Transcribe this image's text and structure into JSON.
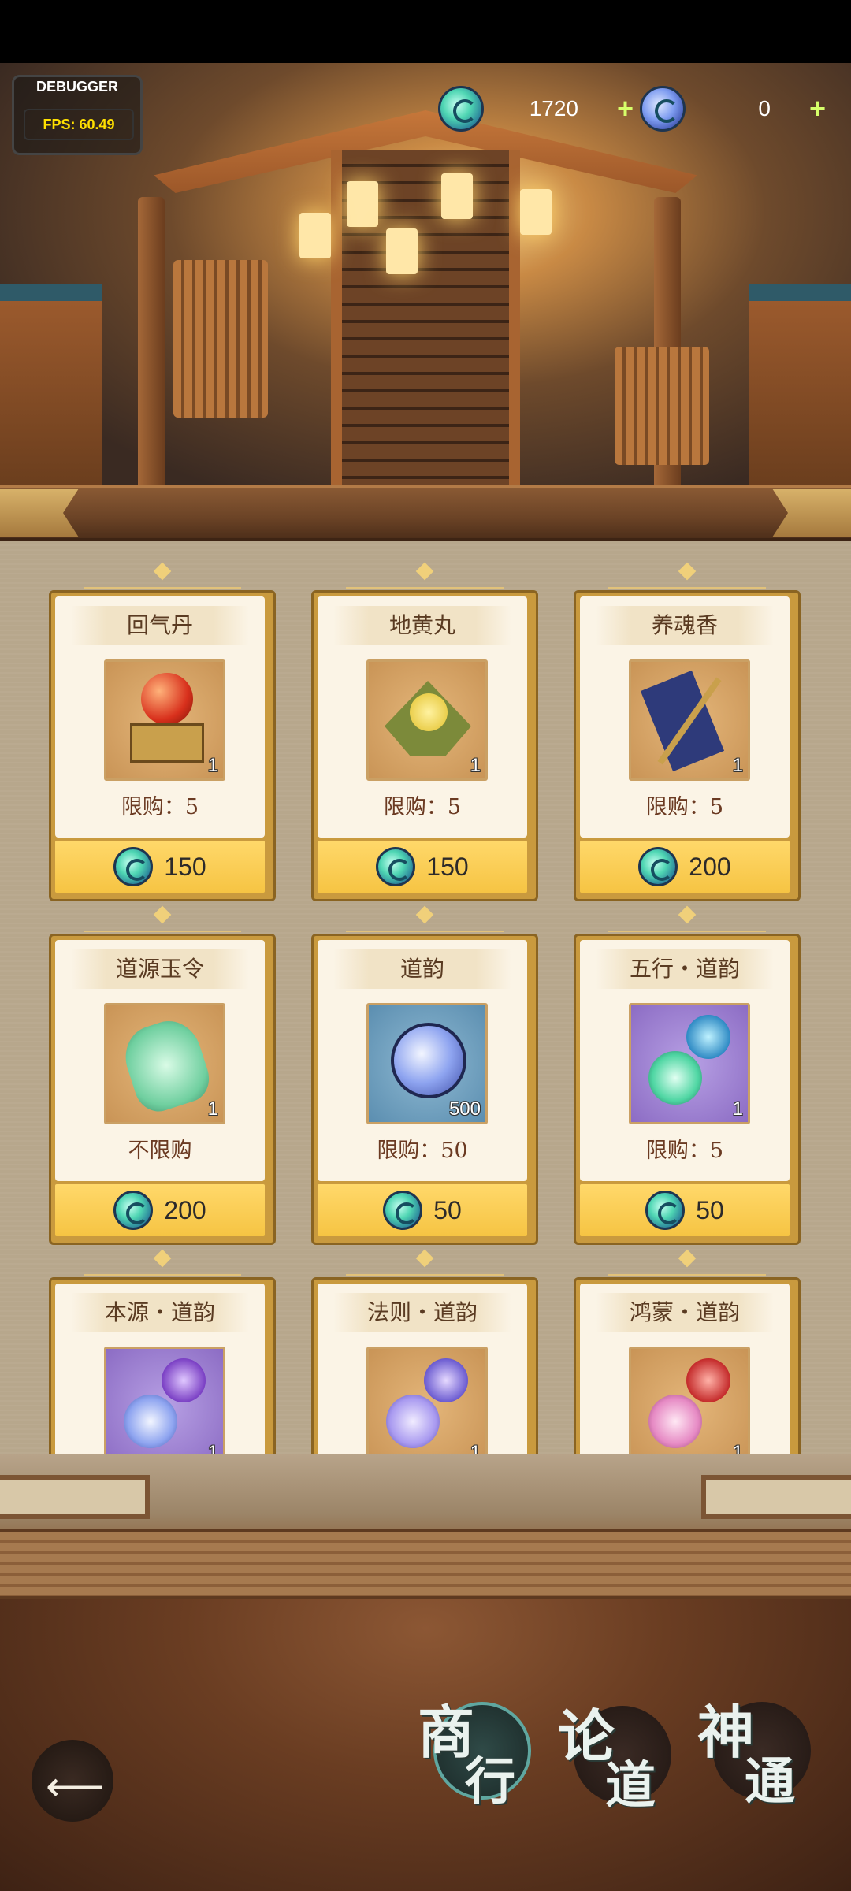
{
  "debugger": {
    "title": "DEBUGGER",
    "fps": "FPS: 60.49"
  },
  "resources": [
    {
      "icon": "jade-coin-icon",
      "value": "1720",
      "plus": "+"
    },
    {
      "icon": "blue-coin-icon",
      "value": "0",
      "plus": "+"
    }
  ],
  "items": [
    {
      "name": "回气丹",
      "qty": "1",
      "limit": "限购：5",
      "price": "150",
      "bg": "gold",
      "icon": "pill-pedestal-icon"
    },
    {
      "name": "地黄丸",
      "qty": "1",
      "limit": "限购：5",
      "price": "150",
      "bg": "gold",
      "icon": "herb-pill-icon"
    },
    {
      "name": "养魂香",
      "qty": "1",
      "limit": "限购：5",
      "price": "200",
      "bg": "gold",
      "icon": "incense-scroll-icon"
    },
    {
      "name": "道源玉令",
      "qty": "1",
      "limit": "不限购",
      "price": "200",
      "bg": "gold",
      "icon": "jade-token-icon"
    },
    {
      "name": "道韵",
      "qty": "500",
      "limit": "限购：50",
      "price": "50",
      "bg": "blue",
      "icon": "dao-orb-icon"
    },
    {
      "name": "五行・道韵",
      "qty": "1",
      "limit": "限购：5",
      "price": "50",
      "bg": "purple",
      "icon": "twin-orb-teal-icon"
    },
    {
      "name": "本源・道韵",
      "qty": "1",
      "limit": "",
      "price": "",
      "bg": "purple",
      "icon": "twin-orb-purple-icon"
    },
    {
      "name": "法则・道韵",
      "qty": "1",
      "limit": "",
      "price": "",
      "bg": "gold",
      "icon": "twin-orb-indigo-icon"
    },
    {
      "name": "鸿蒙・道韵",
      "qty": "1",
      "limit": "",
      "price": "",
      "bg": "gold",
      "icon": "twin-orb-red-icon"
    }
  ],
  "nav": {
    "back_icon": "back-arrow-icon",
    "tabs": [
      {
        "c1": "商",
        "c2": "行",
        "active": true
      },
      {
        "c1": "论",
        "c2": "道",
        "active": false
      },
      {
        "c1": "神",
        "c2": "通",
        "active": false
      }
    ]
  },
  "colors": {
    "price_bar": "#f6c443",
    "card_frame": "#c99a3e",
    "accent_jade": "#4fd6b3"
  }
}
